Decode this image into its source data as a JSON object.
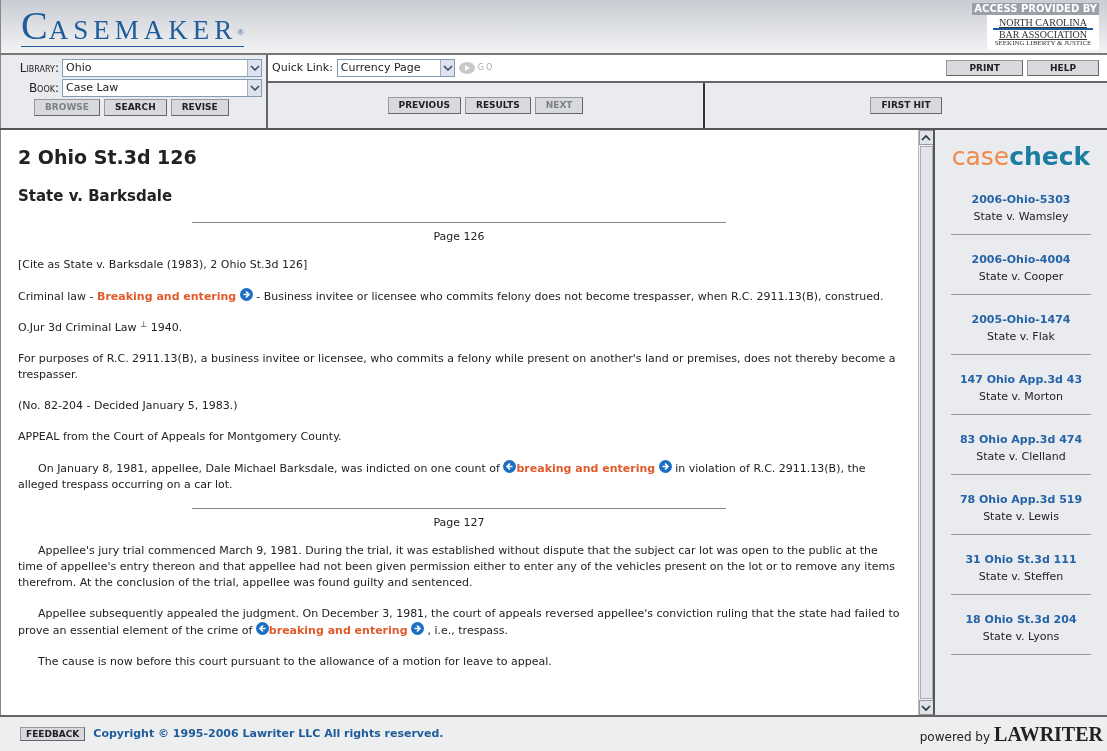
{
  "header": {
    "logo": "CASEMAKER",
    "logo_mark": "®",
    "access_label": "ACCESS PROVIDED BY",
    "sponsor": [
      "NORTH CAROLINA",
      "BAR ASSOCIATION",
      "SEEKING LIBERTY & JUSTICE"
    ]
  },
  "toolbar": {
    "library": {
      "label": "Library:",
      "value": "Ohio"
    },
    "book": {
      "label": "Book:",
      "value": "Case Law"
    },
    "left_buttons": [
      {
        "label": "BROWSE",
        "disabled": true
      },
      {
        "label": "SEARCH",
        "disabled": false
      },
      {
        "label": "REVISE",
        "disabled": false
      }
    ],
    "quick_link": {
      "label": "Quick Link:",
      "value": "Currency Page"
    },
    "go": {
      "label": "GO",
      "disabled": true
    },
    "right_buttons": [
      {
        "label": "PRINT",
        "disabled": false
      },
      {
        "label": "HELP",
        "disabled": false
      }
    ],
    "nav_buttons": [
      {
        "label": "PREVIOUS",
        "disabled": false
      },
      {
        "label": "RESULTS",
        "disabled": false
      },
      {
        "label": "NEXT",
        "disabled": true
      }
    ],
    "first_hit": {
      "label": "FIRST HIT",
      "disabled": false
    }
  },
  "document": {
    "citation": "2 Ohio St.3d 126",
    "case_name": "State v. Barksdale",
    "blocks": [
      {
        "kind": "page",
        "text": "Page 126"
      },
      {
        "kind": "para",
        "indent": false,
        "parts": [
          {
            "kind": "text",
            "text": "[Cite as State v. Barksdale (1983), 2 Ohio St.3d 126]"
          }
        ]
      },
      {
        "kind": "para",
        "indent": false,
        "parts": [
          {
            "kind": "text",
            "text": "Criminal law - "
          },
          {
            "kind": "hit",
            "text": "Breaking and entering",
            "prev": false,
            "next": true
          },
          {
            "kind": "text",
            "text": " - Business invitee or licensee who commits felony does not become trespasser, when R.C. 2911.13(B), construed."
          }
        ]
      },
      {
        "kind": "para",
        "indent": false,
        "parts": [
          {
            "kind": "text",
            "text": "O.Jur 3d Criminal Law $^{⊥}$ 1940."
          }
        ]
      },
      {
        "kind": "para",
        "indent": false,
        "parts": [
          {
            "kind": "text",
            "text": "For purposes of R.C. 2911.13(B), a business invitee or licensee, who commits a felony while present on another's land or premises, does not thereby become a trespasser."
          }
        ]
      },
      {
        "kind": "para",
        "indent": false,
        "parts": [
          {
            "kind": "text",
            "text": "(No. 82-204 - Decided January 5, 1983.)"
          }
        ]
      },
      {
        "kind": "para",
        "indent": false,
        "parts": [
          {
            "kind": "text",
            "text": "APPEAL from the Court of Appeals for Montgomery County."
          }
        ]
      },
      {
        "kind": "para",
        "indent": true,
        "parts": [
          {
            "kind": "text",
            "text": "On January 8, 1981, appellee, Dale Michael Barksdale, was indicted on one count of "
          },
          {
            "kind": "hit",
            "text": "breaking and entering",
            "prev": true,
            "next": true
          },
          {
            "kind": "text",
            "text": " in violation of R.C. 2911.13(B), the alleged trespass occurring on a car lot."
          }
        ]
      },
      {
        "kind": "page",
        "text": "Page 127"
      },
      {
        "kind": "para",
        "indent": true,
        "parts": [
          {
            "kind": "text",
            "text": "Appellee's jury trial commenced March 9, 1981. During the trial, it was established without dispute that the subject car lot was open to the public at the time of appellee's entry thereon and that appellee had not been given permission either to enter any of the vehicles present on the lot or to remove any items therefrom. At the conclusion of the trial, appellee was found guilty and sentenced."
          }
        ]
      },
      {
        "kind": "para",
        "indent": true,
        "parts": [
          {
            "kind": "text",
            "text": "Appellee subsequently appealed the judgment. On December 3, 1981, the court of appeals reversed appellee's conviction ruling that the state had failed to prove an essential element of the crime of "
          },
          {
            "kind": "hit",
            "text": "breaking and entering",
            "prev": true,
            "next": true
          },
          {
            "kind": "text",
            "text": " , i.e., trespass."
          }
        ]
      },
      {
        "kind": "para",
        "indent": true,
        "parts": [
          {
            "kind": "text",
            "text": "The cause is now before this court pursuant to the allowance of a motion for leave to appeal."
          }
        ]
      }
    ]
  },
  "casecheck": {
    "logo": [
      "case",
      "check"
    ],
    "items": [
      {
        "cite": "2006-Ohio-5303",
        "name": "State v. Wamsley"
      },
      {
        "cite": "2006-Ohio-4004",
        "name": "State v. Cooper"
      },
      {
        "cite": "2005-Ohio-1474",
        "name": "State v. Flak"
      },
      {
        "cite": "147 Ohio App.3d 43",
        "name": "State v. Morton"
      },
      {
        "cite": "83 Ohio App.3d 474",
        "name": "State v. Clelland"
      },
      {
        "cite": "78 Ohio App.3d 519",
        "name": "State v. Lewis"
      },
      {
        "cite": "31 Ohio St.3d 111",
        "name": "State v. Steffen"
      },
      {
        "cite": "18 Ohio St.3d 204",
        "name": "State v. Lyons"
      }
    ]
  },
  "footer": {
    "feedback": "FEEDBACK",
    "copyright": "Copyright © 1995-2006 Lawriter LLC All rights reserved.",
    "powered_by": "powered by",
    "brand": "LAWRITER"
  }
}
